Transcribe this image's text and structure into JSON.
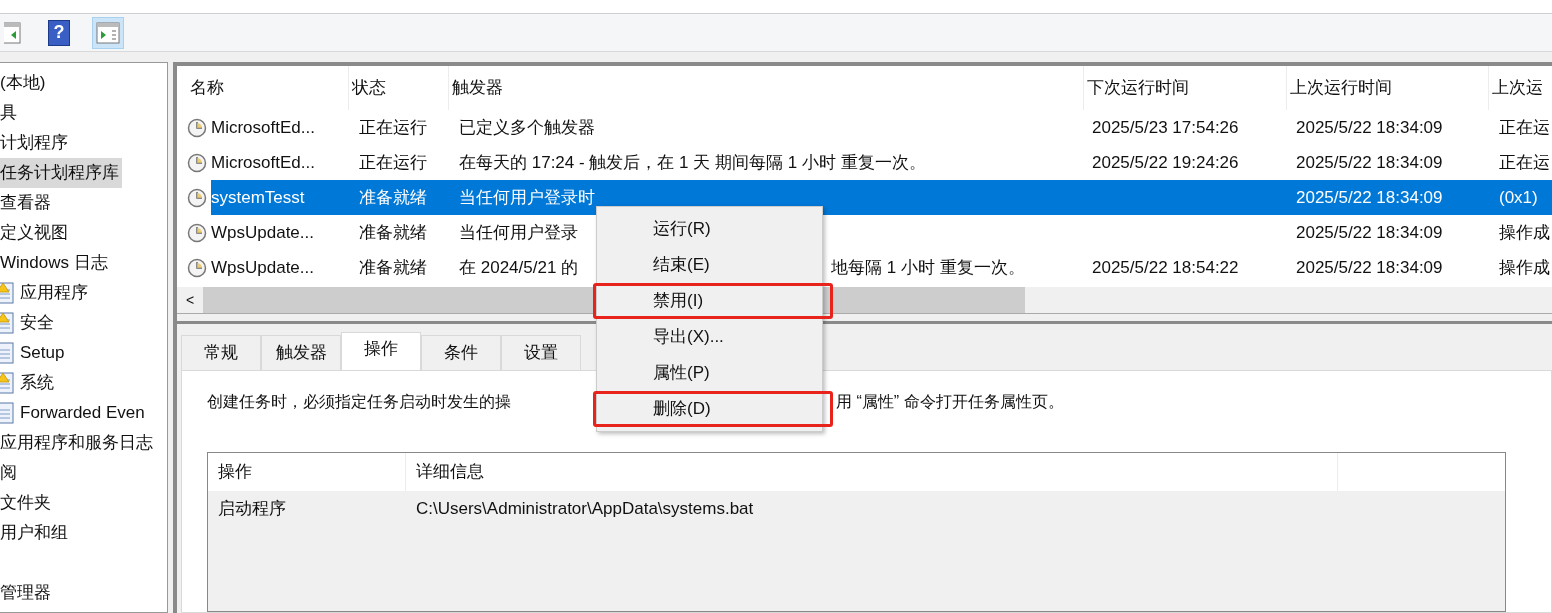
{
  "toolbar": {
    "buttons": [
      {
        "kind": "back",
        "selected": false
      },
      {
        "kind": "help",
        "label": "?",
        "selected": false
      },
      {
        "kind": "pane",
        "selected": true
      }
    ]
  },
  "tree": {
    "items": [
      {
        "label": "(本地)",
        "selected": false
      },
      {
        "label": "具",
        "selected": false
      },
      {
        "label": "计划程序",
        "selected": false
      },
      {
        "label": "任务计划程序库",
        "selected": true
      },
      {
        "label": "查看器",
        "selected": false
      },
      {
        "label": "定义视图",
        "selected": false
      },
      {
        "label": "Windows 日志",
        "selected": false,
        "children": [
          {
            "label": "应用程序",
            "kind": "warning"
          },
          {
            "label": "安全",
            "kind": "warning"
          },
          {
            "label": "Setup",
            "kind": "log"
          },
          {
            "label": "系统",
            "kind": "warning"
          },
          {
            "label": "Forwarded Even",
            "kind": "log"
          }
        ]
      },
      {
        "label": "应用程序和服务日志",
        "selected": false
      },
      {
        "label": "阅",
        "selected": false
      },
      {
        "label": "文件夹",
        "selected": false
      },
      {
        "label": "用户和组",
        "selected": false
      },
      {
        "label": "管理器",
        "selected": false
      }
    ]
  },
  "task_list": {
    "columns": [
      "名称",
      "状态",
      "触发器",
      "下次运行时间",
      "上次运行时间",
      "上次运"
    ],
    "rows": [
      {
        "name": "MicrosoftEd...",
        "status": "正在运行",
        "trigger": "已定义多个触发器",
        "next_run": "2025/5/23 17:54:26",
        "last_run": "2025/5/22 18:34:09",
        "last_result": "正在运",
        "selected": false
      },
      {
        "name": "MicrosoftEd...",
        "status": "正在运行",
        "trigger": "在每天的 17:24 - 触发后，在 1 天 期间每隔 1 小时 重复一次。",
        "next_run": "2025/5/22 19:24:26",
        "last_run": "2025/5/22 18:34:09",
        "last_result": "正在运",
        "selected": false
      },
      {
        "name": "systemTesst",
        "status": "准备就绪",
        "trigger": "当任何用户登录时",
        "last_run": "2025/5/22 18:34:09",
        "last_result": "(0x1)",
        "selected": true
      },
      {
        "name": "WpsUpdate...",
        "status": "准备就绪",
        "trigger": "当任何用户登录",
        "last_run": "2025/5/22 18:34:09",
        "last_result": "操作成",
        "selected": false
      },
      {
        "name": "WpsUpdate...",
        "status": "准备就绪",
        "trigger": "在 2024/5/21 的",
        "trigger_tail": "地每隔 1 小时 重复一次。",
        "next_run": "2025/5/22 18:54:22",
        "last_run": "2025/5/22 18:34:09",
        "last_result": "操作成",
        "selected": false
      }
    ],
    "scroll_left": "<"
  },
  "tabs": [
    {
      "label": "常规",
      "selected": false
    },
    {
      "label": "触发器",
      "selected": false
    },
    {
      "label": "操作",
      "selected": true
    },
    {
      "label": "条件",
      "selected": false
    },
    {
      "label": "设置",
      "selected": false
    }
  ],
  "description": {
    "head": "创建任务时，必须指定任务启动时发生的操",
    "tail": "用 “属性” 命令打开任务属性页。"
  },
  "actions_table": {
    "columns": [
      "操作",
      "详细信息"
    ],
    "rows": [
      {
        "action": "启动程序",
        "details": "C:\\Users\\Administrator\\AppData\\systems.bat"
      }
    ]
  },
  "context_menu": {
    "items": [
      {
        "label": "运行(R)",
        "annotated": false
      },
      {
        "label": "结束(E)",
        "annotated": false
      },
      {
        "label": "禁用(I)",
        "annotated": true
      },
      {
        "label": "导出(X)...",
        "annotated": false
      },
      {
        "label": "属性(P)",
        "annotated": false
      },
      {
        "label": "删除(D)",
        "annotated": true
      }
    ]
  }
}
